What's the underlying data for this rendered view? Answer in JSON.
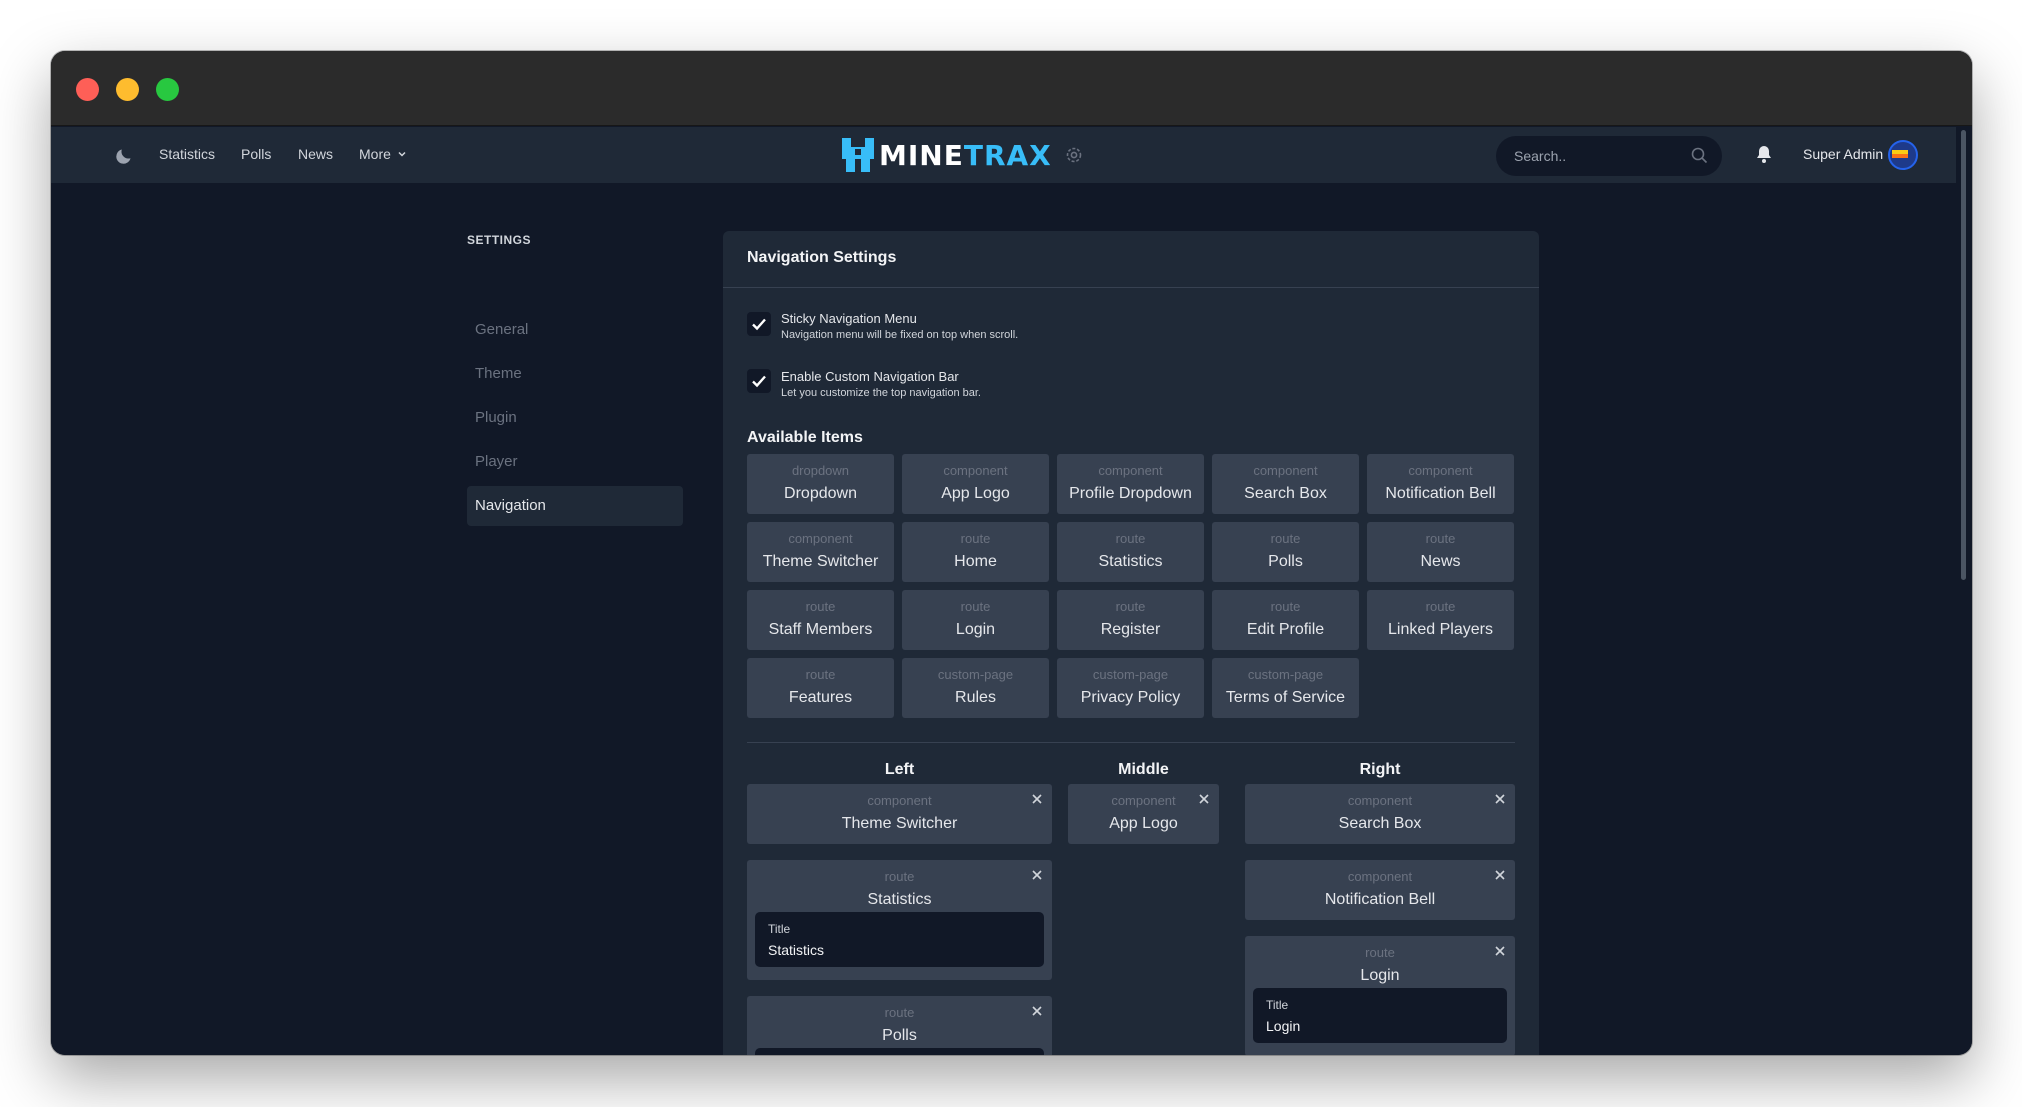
{
  "nav": {
    "links": [
      "Statistics",
      "Polls",
      "News"
    ],
    "more_label": "More",
    "logo_left": "MINE",
    "logo_right": "TRAX",
    "search_placeholder": "Search..",
    "user_name": "Super Admin"
  },
  "sidebar": {
    "heading": "SETTINGS",
    "items": [
      "General",
      "Theme",
      "Plugin",
      "Player",
      "Navigation"
    ],
    "active": "Navigation"
  },
  "panel": {
    "title": "Navigation Settings",
    "options": [
      {
        "label": "Sticky Navigation Menu",
        "description": "Navigation menu will be fixed on top when scroll.",
        "checked": true
      },
      {
        "label": "Enable Custom Navigation Bar",
        "description": "Let you customize the top navigation bar.",
        "checked": true
      }
    ],
    "available_title": "Available Items",
    "available_items": [
      {
        "type": "dropdown",
        "label": "Dropdown"
      },
      {
        "type": "component",
        "label": "App Logo"
      },
      {
        "type": "component",
        "label": "Profile Dropdown"
      },
      {
        "type": "component",
        "label": "Search Box"
      },
      {
        "type": "component",
        "label": "Notification Bell"
      },
      {
        "type": "component",
        "label": "Theme Switcher"
      },
      {
        "type": "route",
        "label": "Home"
      },
      {
        "type": "route",
        "label": "Statistics"
      },
      {
        "type": "route",
        "label": "Polls"
      },
      {
        "type": "route",
        "label": "News"
      },
      {
        "type": "route",
        "label": "Staff Members"
      },
      {
        "type": "route",
        "label": "Login"
      },
      {
        "type": "route",
        "label": "Register"
      },
      {
        "type": "route",
        "label": "Edit Profile"
      },
      {
        "type": "route",
        "label": "Linked Players"
      },
      {
        "type": "route",
        "label": "Features"
      },
      {
        "type": "custom-page",
        "label": "Rules"
      },
      {
        "type": "custom-page",
        "label": "Privacy Policy"
      },
      {
        "type": "custom-page",
        "label": "Terms of Service"
      }
    ],
    "columns": {
      "left": {
        "title": "Left",
        "items": [
          {
            "type": "component",
            "label": "Theme Switcher"
          },
          {
            "type": "route",
            "label": "Statistics",
            "title_label": "Title",
            "title_value": "Statistics"
          },
          {
            "type": "route",
            "label": "Polls"
          }
        ]
      },
      "middle": {
        "title": "Middle",
        "items": [
          {
            "type": "component",
            "label": "App Logo"
          }
        ]
      },
      "right": {
        "title": "Right",
        "items": [
          {
            "type": "component",
            "label": "Search Box"
          },
          {
            "type": "component",
            "label": "Notification Bell"
          },
          {
            "type": "route",
            "label": "Login",
            "title_label": "Title",
            "title_value": "Login"
          }
        ]
      }
    }
  },
  "colors": {
    "background": "#111827",
    "surface": "#1f2937",
    "card": "#374151",
    "accent": "#38bdf8"
  }
}
